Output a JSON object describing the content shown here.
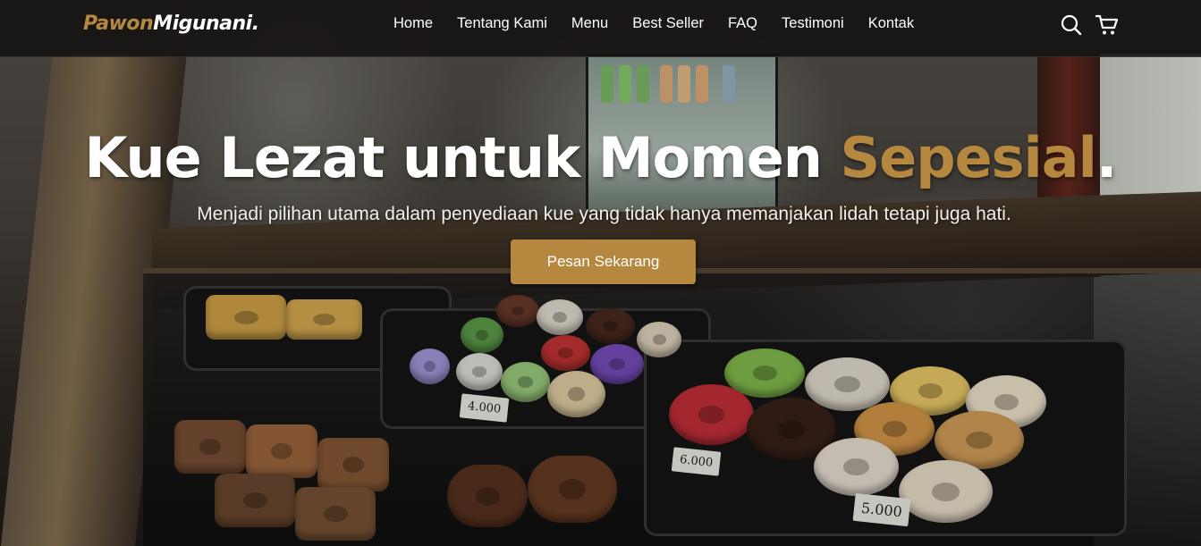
{
  "brand": {
    "part1": "Pawon",
    "part2": "Migunani."
  },
  "nav": {
    "links": [
      "Home",
      "Tentang Kami",
      "Menu",
      "Best Seller",
      "FAQ",
      "Testimoni",
      "Kontak"
    ]
  },
  "icons": {
    "search": "search-icon",
    "cart": "cart-icon"
  },
  "hero": {
    "title_main": "Kue Lezat untuk Momen ",
    "title_accent": "Sepesial",
    "title_end": ".",
    "subtitle": "Menjadi pilihan utama dalam penyediaan kue yang tidak hanya memanjakan lidah tetapi juga hati.",
    "cta_label": "Pesan Sekarang"
  },
  "price_tags": [
    "4.000",
    "6.000",
    "5.000"
  ],
  "colors": {
    "accent": "#b6883f",
    "navbar": "#161412",
    "text": "#ffffff"
  }
}
